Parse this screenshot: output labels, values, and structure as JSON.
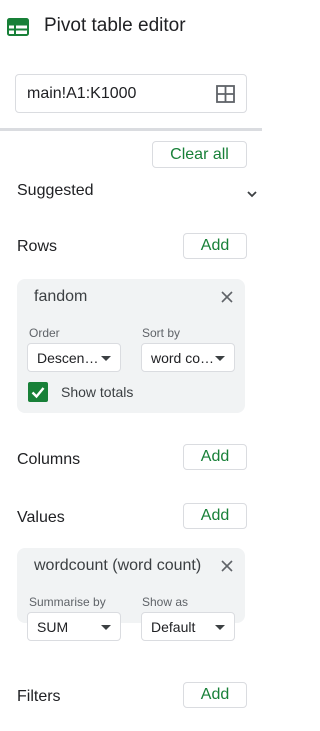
{
  "header": {
    "title": "Pivot table editor",
    "icon": "sheets-table-icon"
  },
  "range": {
    "value": "main!A1:K1000",
    "icon": "grid-select-icon"
  },
  "actions": {
    "clear_all": "Clear all"
  },
  "sections": {
    "suggested": {
      "label": "Suggested"
    },
    "rows": {
      "label": "Rows",
      "add": "Add",
      "card": {
        "title": "fandom",
        "order_label": "Order",
        "order_value": "Descen…",
        "sort_label": "Sort by",
        "sort_value": "word co…",
        "show_totals": "Show totals",
        "show_totals_checked": true
      }
    },
    "columns": {
      "label": "Columns",
      "add": "Add"
    },
    "values": {
      "label": "Values",
      "add": "Add",
      "card": {
        "title": "wordcount (word count)",
        "summarise_label": "Summarise by",
        "summarise_value": "SUM",
        "showas_label": "Show as",
        "showas_value": "Default"
      }
    },
    "filters": {
      "label": "Filters",
      "add": "Add"
    }
  },
  "colors": {
    "accent": "#188038",
    "card_bg": "#f1f3f4",
    "border": "#dadce0"
  }
}
